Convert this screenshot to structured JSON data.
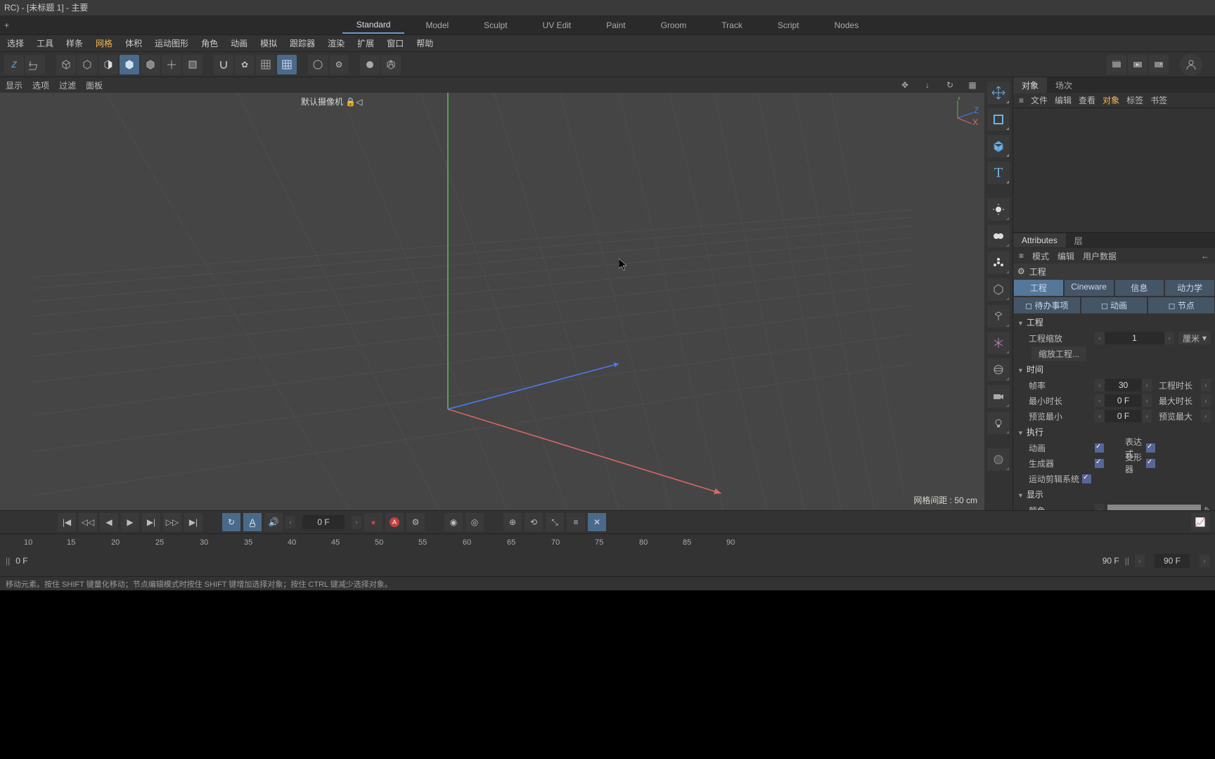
{
  "title": "RC) - [未标题 1] - 主要",
  "layouts": [
    "Standard",
    "Model",
    "Sculpt",
    "UV Edit",
    "Paint",
    "Groom",
    "Track",
    "Script",
    "Nodes"
  ],
  "active_layout": 0,
  "menu": [
    "选择",
    "工具",
    "样条",
    "网格",
    "体积",
    "运动图形",
    "角色",
    "动画",
    "模拟",
    "跟踪器",
    "渲染",
    "扩展",
    "窗口",
    "帮助"
  ],
  "menu_active": 3,
  "tool_label1": "Z",
  "vp_menu": [
    "显示",
    "选项",
    "过滤",
    "面板"
  ],
  "camera_label": "默认摄像机",
  "grid_dist": "网格间距 : 50 cm",
  "axes": {
    "x": "X",
    "y": "Y",
    "z": "Z"
  },
  "obj_panel": {
    "tabs": [
      "对象",
      "场次"
    ],
    "menu": [
      "文件",
      "编辑",
      "查看",
      "对象",
      "标签",
      "书签"
    ],
    "menu_active": 3
  },
  "attr_panel": {
    "tabs": [
      "Attributes",
      "层"
    ],
    "menu": [
      "模式",
      "编辑",
      "用户数据"
    ],
    "project": "工程",
    "sub_tabs": [
      "工程",
      "Cineware",
      "信息",
      "动力学"
    ],
    "sub_tabs2": [
      "待办事项",
      "动画",
      "节点"
    ],
    "fields": {
      "scale_label": "工程缩放",
      "scale_value": "1",
      "scale_unit": "厘米",
      "scale_button": "缩放工程...",
      "time_section": "时间",
      "fps_label": "帧率",
      "fps_value": "30",
      "duration_label": "工程时长",
      "min_label": "最小时长",
      "min_value": "0 F",
      "max_label": "最大时长",
      "preview_min_label": "预览最小",
      "preview_min_value": "0 F",
      "preview_max_label": "预览最大",
      "exec_section": "执行",
      "anim_label": "动画",
      "expr_label": "表达式",
      "gen_label": "生成器",
      "deform_label": "变形器",
      "motion_label": "运动剪辑系统",
      "display_section": "显示",
      "color_label": "颜色"
    }
  },
  "timeline": {
    "frame_current": "0 F",
    "ticks": [
      "10",
      "15",
      "20",
      "25",
      "30",
      "35",
      "40",
      "45",
      "50",
      "55",
      "60",
      "65",
      "70",
      "75",
      "80",
      "85",
      "90"
    ],
    "frame_start": "0 F",
    "frame_end": "90 F",
    "frame_end2": "90 F"
  },
  "status": "移动元素。按住 SHIFT 键量化移动；节点编辑模式时按住 SHIFT 键增加选择对象；按住 CTRL 键减少选择对象。"
}
